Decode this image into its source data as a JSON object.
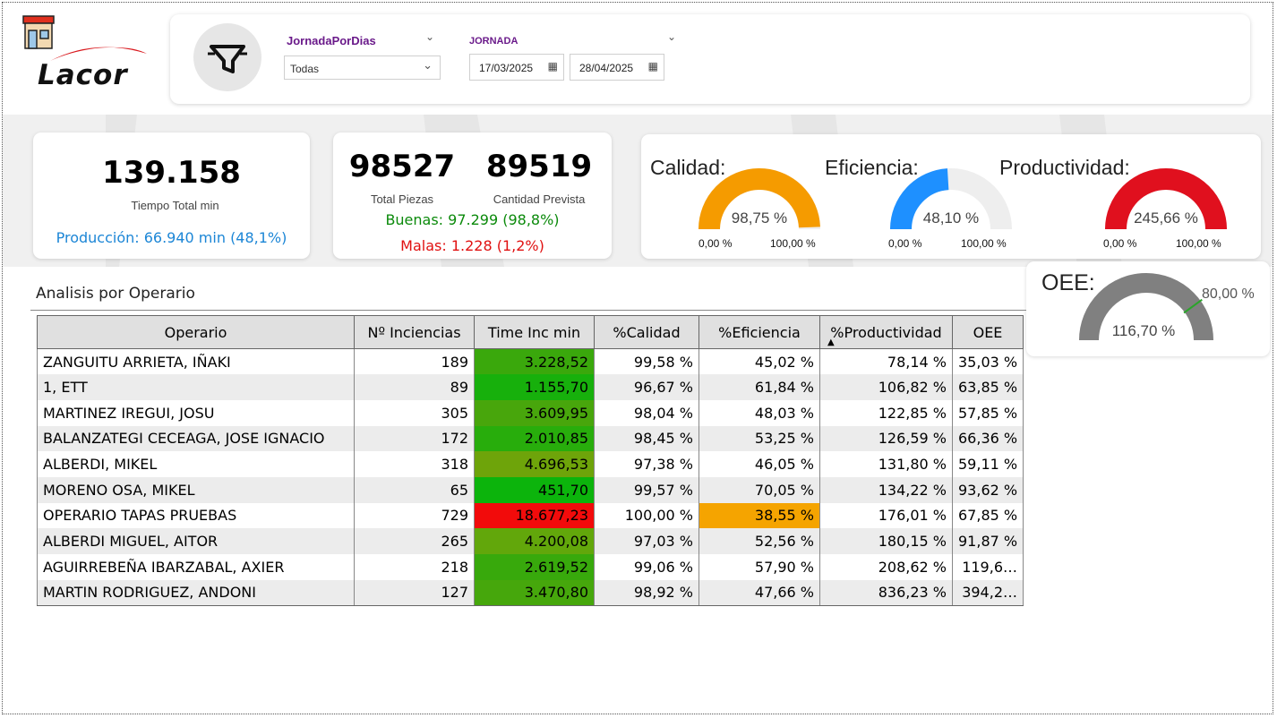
{
  "brand": {
    "logo_text": "Lacor",
    "store_icon": "store-icon"
  },
  "filters": {
    "jornada_por_dias": {
      "title": "JornadaPorDias",
      "value": "Todas"
    },
    "jornada": {
      "title": "JORNADA",
      "date_from": "17/03/2025",
      "date_to": "28/04/2025"
    },
    "icon": "filter-funnel-icon"
  },
  "kpi_time": {
    "value": "139.158",
    "label": "Tiempo Total min",
    "produccion": "Producción: 66.940 min (48,1%)"
  },
  "kpi_pieces": {
    "total": "98527",
    "total_label": "Total Piezas",
    "prevista": "89519",
    "prevista_label": "Cantidad Prevista",
    "buenas": "Buenas: 97.299 (98,8%)",
    "malas": "Malas: 1.228 (1,2%)"
  },
  "gauges": [
    {
      "title": "Calidad:",
      "value": "98,75 %",
      "min": "0,00 %",
      "max": "100,00 %",
      "fraction": 0.9875,
      "color": "#F59B00"
    },
    {
      "title": "Eficiencia:",
      "value": "48,10 %",
      "min": "0,00 %",
      "max": "100,00 %",
      "fraction": 0.481,
      "color": "#1E90FF"
    },
    {
      "title": "Productividad:",
      "value": "245,66 %",
      "min": "0,00 %",
      "max": "100,00 %",
      "fraction": 1.0,
      "color": "#E0101E"
    }
  ],
  "oee": {
    "title": "OEE:",
    "value": "116,70 %",
    "target": "80,00 %",
    "fraction": 1.0,
    "target_fraction": 0.8,
    "color": "#808080",
    "target_color": "#2aa52a"
  },
  "table": {
    "title": "Analisis por Operario",
    "columns": [
      "Operario",
      "Nº Inciencias",
      "Time Inc min",
      "%Calidad",
      "%Eficiencia",
      "%Productividad",
      "OEE"
    ],
    "sorted_column": "%Productividad",
    "rows": [
      {
        "operario": "ZANGUITU ARRIETA, IÑAKI",
        "incidencias": "189",
        "time": "3.228,52",
        "time_color": "#3aa80c",
        "calidad": "99,58 %",
        "eficiencia": "45,02 %",
        "efic_color": "",
        "productividad": "78,14 %",
        "oee": "35,03 %"
      },
      {
        "operario": "1, ETT",
        "incidencias": "89",
        "time": "1.155,70",
        "time_color": "#17b00c",
        "calidad": "96,67 %",
        "eficiencia": "61,84 %",
        "efic_color": "",
        "productividad": "106,82 %",
        "oee": "63,85 %"
      },
      {
        "operario": "MARTINEZ IREGUI, JOSU",
        "incidencias": "305",
        "time": "3.609,95",
        "time_color": "#48a60c",
        "calidad": "98,04 %",
        "eficiencia": "48,03 %",
        "efic_color": "",
        "productividad": "122,85 %",
        "oee": "57,85 %"
      },
      {
        "operario": "BALANZATEGI CECEAGA, JOSE IGNACIO",
        "incidencias": "172",
        "time": "2.010,85",
        "time_color": "#28ad0c",
        "calidad": "98,45 %",
        "eficiencia": "53,25 %",
        "efic_color": "",
        "productividad": "126,59 %",
        "oee": "66,36 %"
      },
      {
        "operario": "ALBERDI, MIKEL",
        "incidencias": "318",
        "time": "4.696,53",
        "time_color": "#6ea40a",
        "calidad": "97,38 %",
        "eficiencia": "46,05 %",
        "efic_color": "",
        "productividad": "131,80 %",
        "oee": "59,11 %"
      },
      {
        "operario": "MORENO OSA, MIKEL",
        "incidencias": "65",
        "time": "451,70",
        "time_color": "#0cb40c",
        "calidad": "99,57 %",
        "eficiencia": "70,05 %",
        "efic_color": "",
        "productividad": "134,22 %",
        "oee": "93,62 %"
      },
      {
        "operario": "OPERARIO TAPAS PRUEBAS",
        "incidencias": "729",
        "time": "18.677,23",
        "time_color": "#f20b0b",
        "calidad": "100,00 %",
        "eficiencia": "38,55 %",
        "efic_color": "#f5a400",
        "productividad": "176,01 %",
        "oee": "67,85 %"
      },
      {
        "operario": "ALBERDI MIGUEL, AITOR",
        "incidencias": "265",
        "time": "4.200,08",
        "time_color": "#62a70b",
        "calidad": "97,03 %",
        "eficiencia": "52,56 %",
        "efic_color": "",
        "productividad": "180,15 %",
        "oee": "91,87 %"
      },
      {
        "operario": "AGUIRREBEÑA IBARZABAL, AXIER",
        "incidencias": "218",
        "time": "2.619,52",
        "time_color": "#38a90c",
        "calidad": "99,06 %",
        "eficiencia": "57,90 %",
        "efic_color": "",
        "productividad": "208,62 %",
        "oee": "119,6…"
      },
      {
        "operario": "MARTIN RODRIGUEZ, ANDONI",
        "incidencias": "127",
        "time": "3.470,80",
        "time_color": "#46a70c",
        "calidad": "98,92 %",
        "eficiencia": "47,66 %",
        "efic_color": "",
        "productividad": "836,23 %",
        "oee": "394,2…"
      }
    ]
  }
}
